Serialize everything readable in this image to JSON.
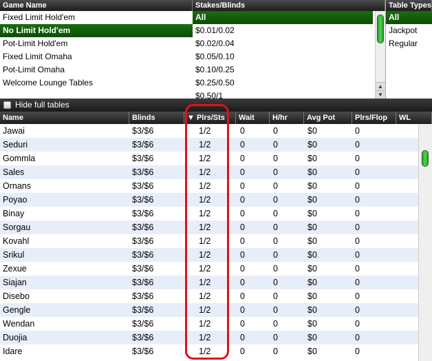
{
  "game_panel": {
    "header": "Game Name",
    "items": [
      "Fixed Limit Hold'em",
      "No Limit Hold'em",
      "Pot-Limit Hold'em",
      "Fixed Limit Omaha",
      "Pot-Limit Omaha",
      "Welcome Lounge Tables"
    ],
    "selected": 1
  },
  "stakes_panel": {
    "header": "Stakes/Blinds",
    "items": [
      "All",
      "$0.01/0.02",
      "$0.02/0.04",
      "$0.05/0.10",
      "$0.10/0.25",
      "$0.25/0.50",
      "$0.50/1"
    ],
    "selected": 0,
    "scroll_arrow_up": "▲",
    "scroll_arrow_down": "▼"
  },
  "types_panel": {
    "header": "Table Types",
    "items": [
      "All",
      "Jackpot",
      "Regular"
    ],
    "selected": 0
  },
  "hide_full_tables": {
    "label": "Hide full tables",
    "checked": false
  },
  "table": {
    "columns": [
      "Name",
      "Blinds",
      "▼ Plrs/Sts",
      "Wait",
      "H/hr",
      "Avg Pot",
      "Plrs/Flop",
      "WL"
    ],
    "rows": [
      [
        "Jawai",
        "$3/$6",
        "1/2",
        "0",
        "0",
        "$0",
        "0",
        ""
      ],
      [
        "Seduri",
        "$3/$6",
        "1/2",
        "0",
        "0",
        "$0",
        "0",
        ""
      ],
      [
        "Gommla",
        "$3/$6",
        "1/2",
        "0",
        "0",
        "$0",
        "0",
        ""
      ],
      [
        "Sales",
        "$3/$6",
        "1/2",
        "0",
        "0",
        "$0",
        "0",
        ""
      ],
      [
        "Ornans",
        "$3/$6",
        "1/2",
        "0",
        "0",
        "$0",
        "0",
        ""
      ],
      [
        "Poyao",
        "$3/$6",
        "1/2",
        "0",
        "0",
        "$0",
        "0",
        ""
      ],
      [
        "Binay",
        "$3/$6",
        "1/2",
        "0",
        "0",
        "$0",
        "0",
        ""
      ],
      [
        "Sorgau",
        "$3/$6",
        "1/2",
        "0",
        "0",
        "$0",
        "0",
        ""
      ],
      [
        "Kovahl",
        "$3/$6",
        "1/2",
        "0",
        "0",
        "$0",
        "0",
        ""
      ],
      [
        "Srikul",
        "$3/$6",
        "1/2",
        "0",
        "0",
        "$0",
        "0",
        ""
      ],
      [
        "Zexue",
        "$3/$6",
        "1/2",
        "0",
        "0",
        "$0",
        "0",
        ""
      ],
      [
        "Siajan",
        "$3/$6",
        "1/2",
        "0",
        "0",
        "$0",
        "0",
        ""
      ],
      [
        "Disebo",
        "$3/$6",
        "1/2",
        "0",
        "0",
        "$0",
        "0",
        ""
      ],
      [
        "Gengle",
        "$3/$6",
        "1/2",
        "0",
        "0",
        "$0",
        "0",
        ""
      ],
      [
        "Wendan",
        "$3/$6",
        "1/2",
        "0",
        "0",
        "$0",
        "0",
        ""
      ],
      [
        "Duojia",
        "$3/$6",
        "1/2",
        "0",
        "0",
        "$0",
        "0",
        ""
      ],
      [
        "Idare",
        "$3/$6",
        "1/2",
        "0",
        "0",
        "$0",
        "0",
        ""
      ]
    ]
  },
  "colors": {
    "selection_green": "#0f5a08",
    "highlight_red": "#e0101a",
    "row_stripe": "#e8eef9"
  }
}
